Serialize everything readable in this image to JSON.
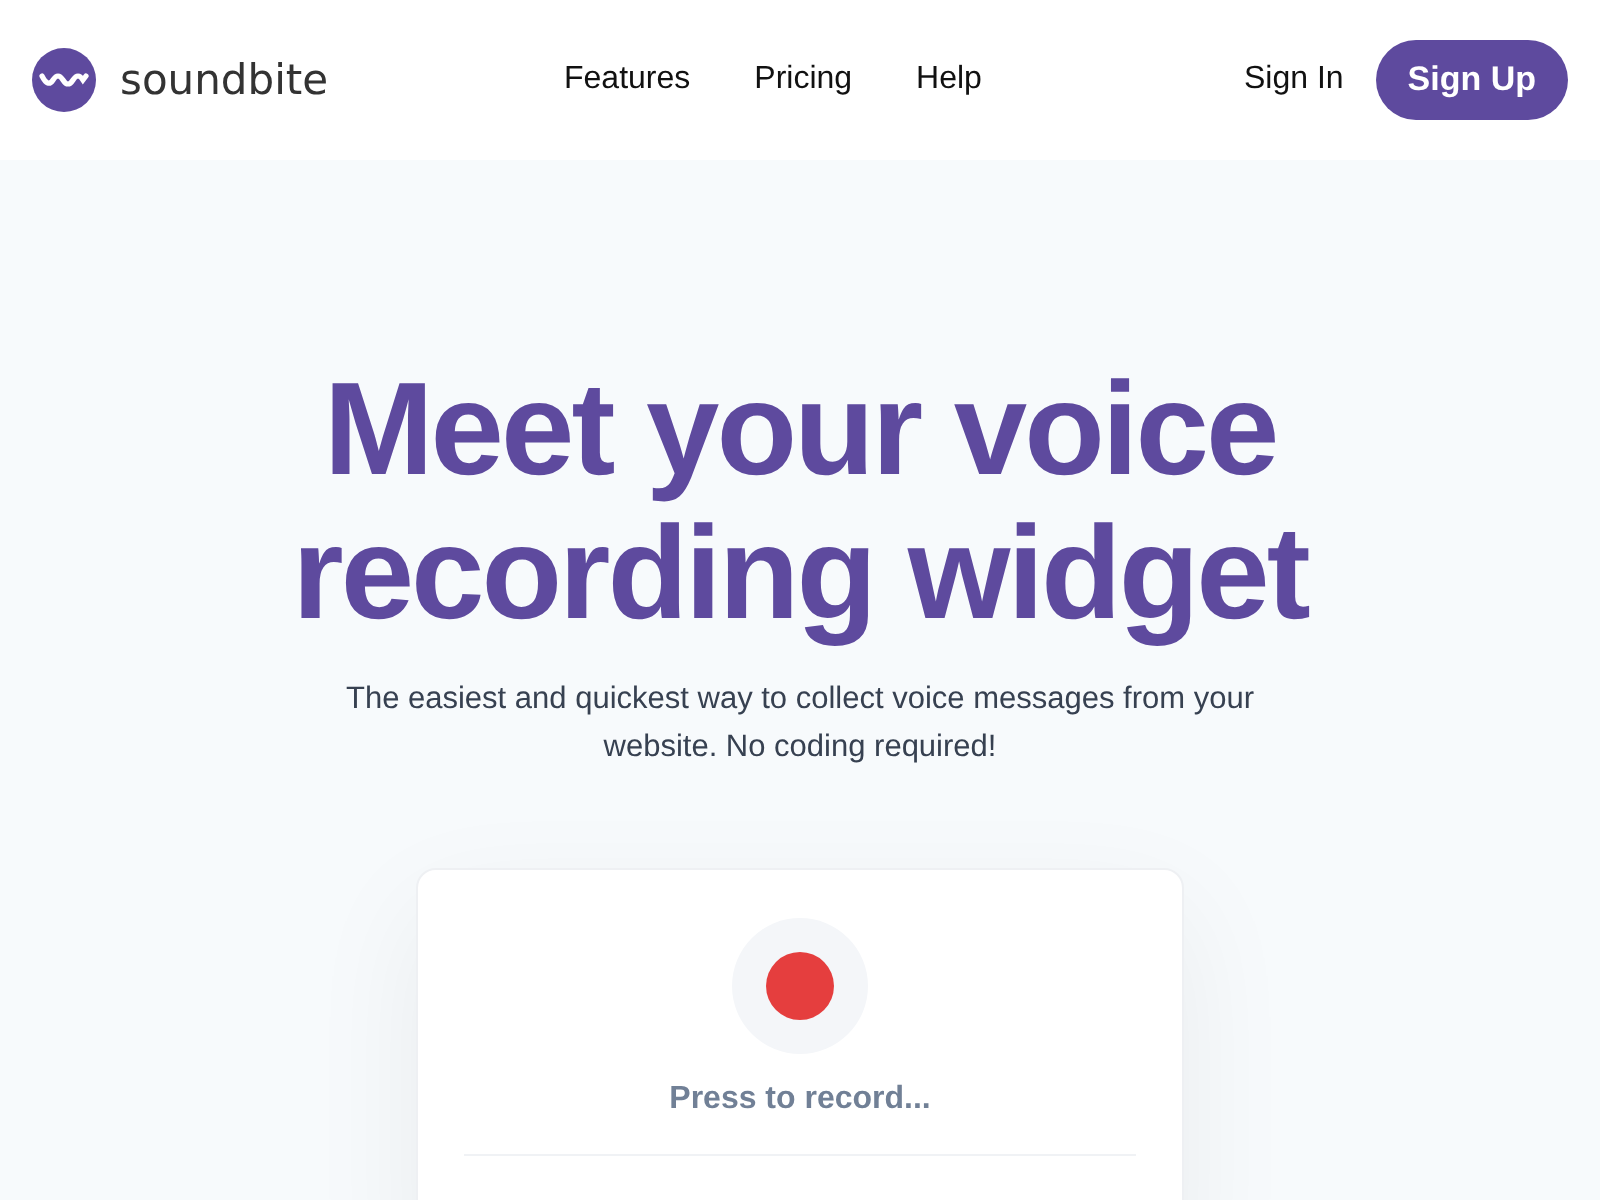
{
  "brand": {
    "name": "soundbite"
  },
  "nav": [
    {
      "label": "Features"
    },
    {
      "label": "Pricing"
    },
    {
      "label": "Help"
    }
  ],
  "auth": {
    "sign_in": "Sign In",
    "sign_up": "Sign Up"
  },
  "hero": {
    "title_lines": [
      "Meet your voice",
      "recording widget"
    ],
    "subtitle": "The easiest and quickest way to collect voice messages from your website. No coding required!"
  },
  "widget": {
    "prompt": "Press to record..."
  }
}
